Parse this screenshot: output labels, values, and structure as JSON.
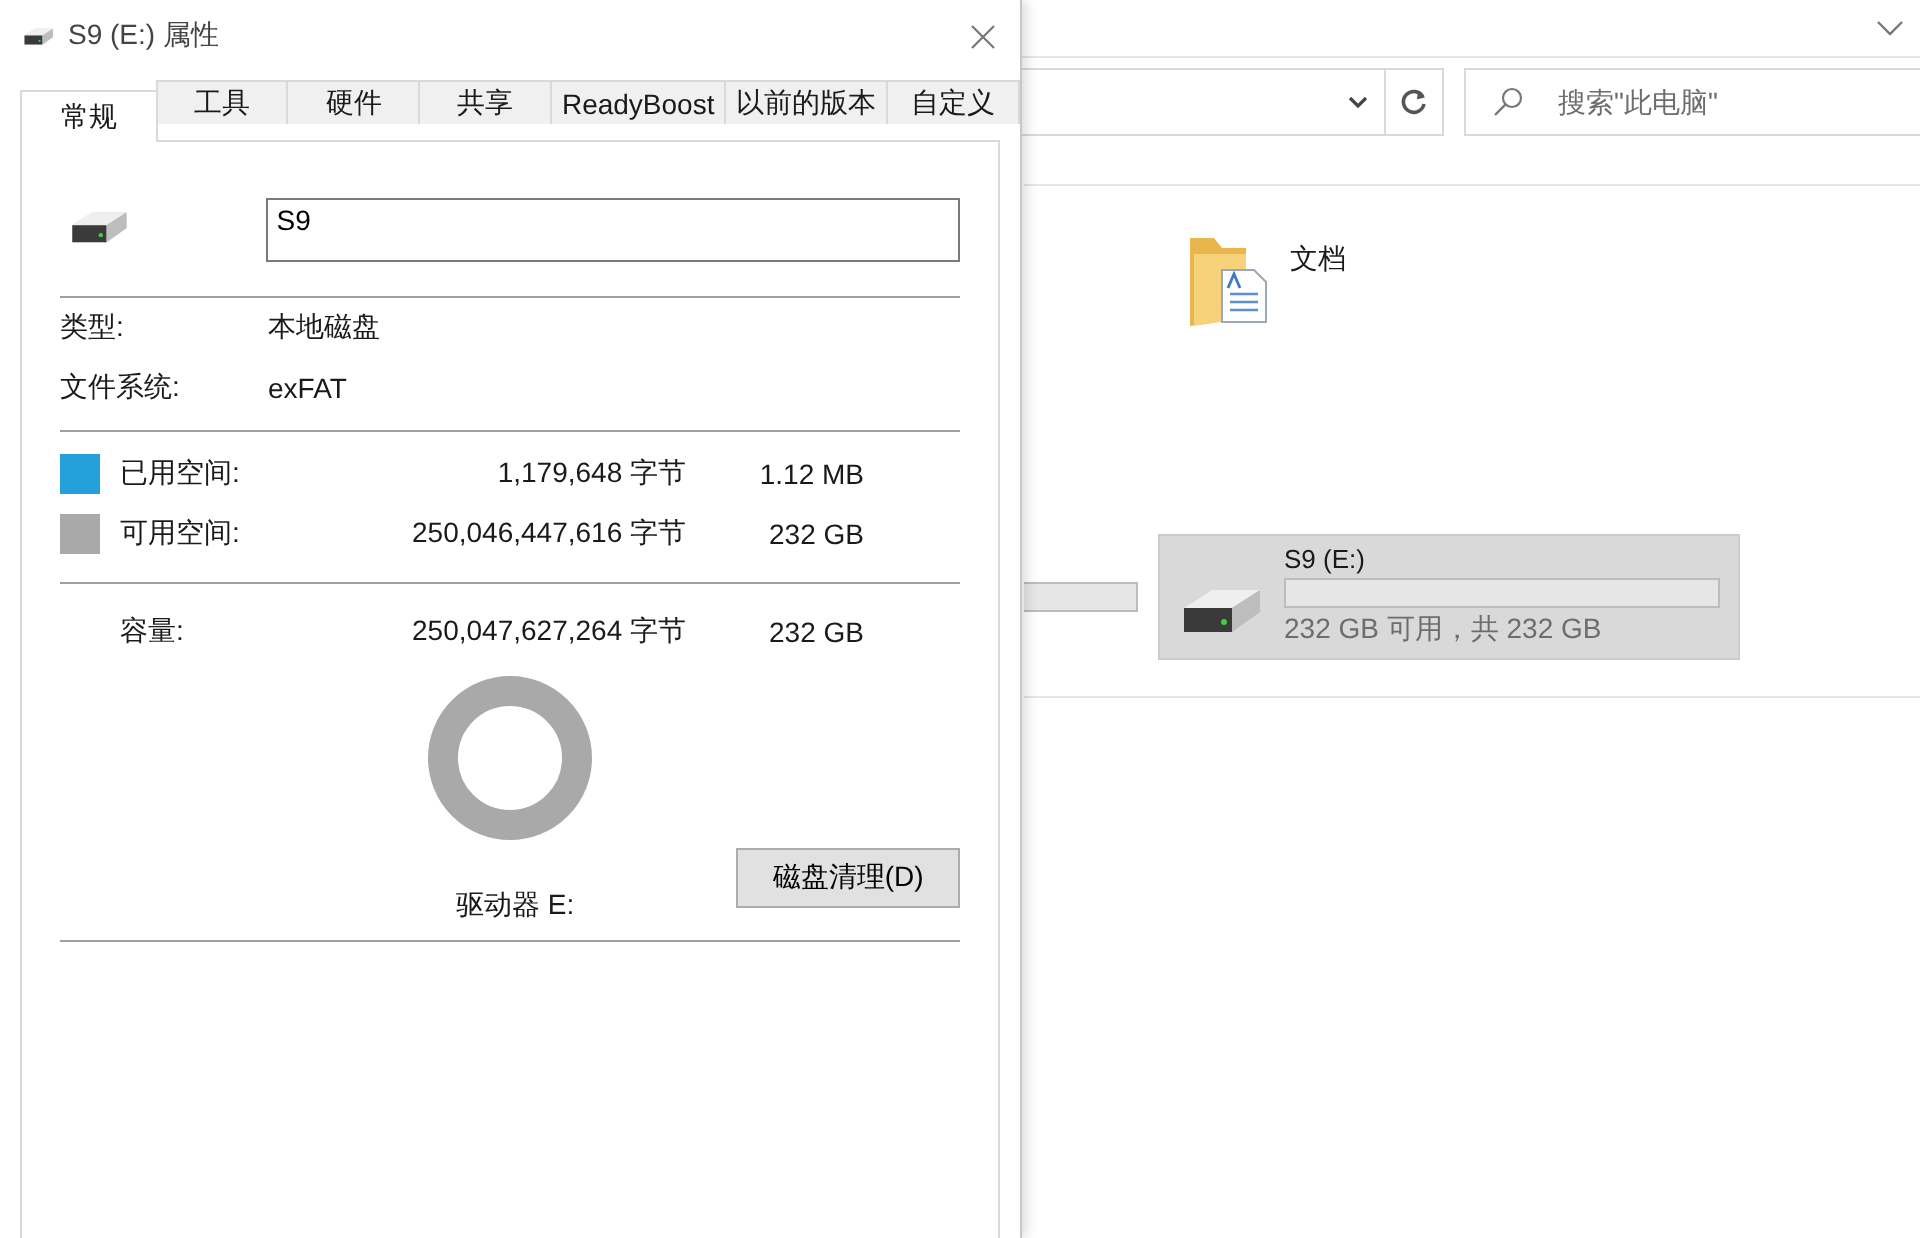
{
  "explorer": {
    "search": {
      "placeholder": "搜索\"此电脑\""
    },
    "folders": [
      {
        "name": "文档"
      }
    ],
    "drives": [
      {
        "name": "S9 (E:)",
        "free_text": "232 GB 可用，共 232 GB",
        "selected": true
      }
    ]
  },
  "dialog": {
    "title": "S9 (E:) 属性",
    "tabs": [
      {
        "label": "常规",
        "selected": true
      },
      {
        "label": "工具",
        "selected": false
      },
      {
        "label": "硬件",
        "selected": false
      },
      {
        "label": "共享",
        "selected": false
      },
      {
        "label": "ReadyBoost",
        "selected": false
      },
      {
        "label": "以前的版本",
        "selected": false
      },
      {
        "label": "自定义",
        "selected": false
      }
    ],
    "name_field": {
      "value": "S9"
    },
    "details": [
      {
        "label": "类型:",
        "value": "本地磁盘"
      },
      {
        "label": "文件系统:",
        "value": "exFAT"
      }
    ],
    "space": [
      {
        "label": "已用空间:",
        "bytes": "1,179,648 字节",
        "size": "1.12 MB",
        "color": "#26a0da"
      },
      {
        "label": "可用空间:",
        "bytes": "250,046,447,616 字节",
        "size": "232 GB",
        "color": "#a9a9a9"
      }
    ],
    "capacity": {
      "label": "容量:",
      "bytes": "250,047,627,264 字节",
      "size": "232 GB"
    },
    "drive_label": "驱动器 E:",
    "cleanup_button": "磁盘清理(D)"
  }
}
